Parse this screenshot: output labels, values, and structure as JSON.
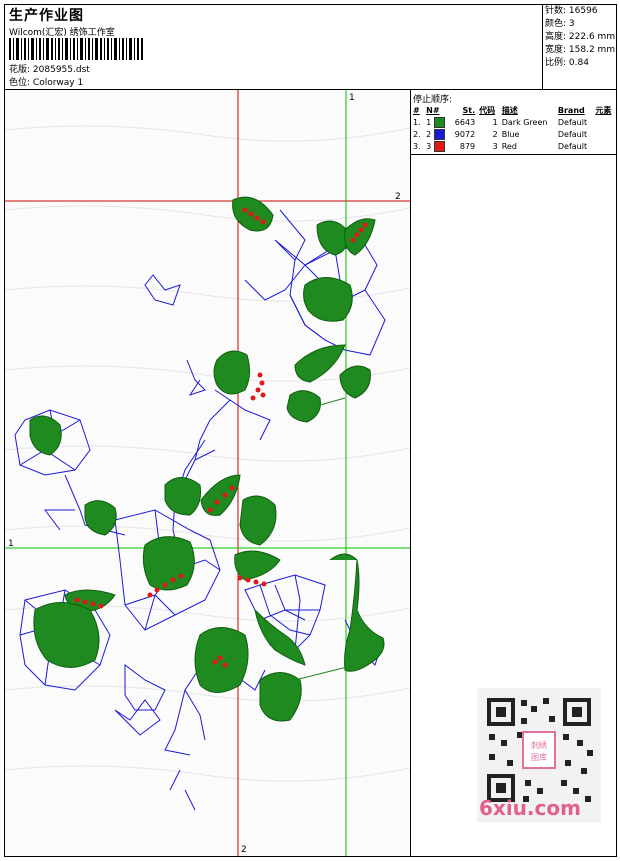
{
  "header": {
    "title": "生产作业图",
    "subtitle": "Wilcom(汇宏) 绣饰工作室",
    "design_label": "花版:",
    "design_value": "2085955.dst",
    "colorway_label": "色位:",
    "colorway_value": "Colorway 1"
  },
  "stats": [
    {
      "label": "针数:",
      "value": "16596"
    },
    {
      "label": "颜色:",
      "value": "3"
    },
    {
      "label": "高度:",
      "value": "222.6 mm"
    },
    {
      "label": "宽度:",
      "value": "158.2 mm"
    },
    {
      "label": "比例:",
      "value": "0.84"
    }
  ],
  "stop_sequence": {
    "caption": "停止顺序:",
    "columns": [
      "#",
      "N#",
      "St.",
      "代码",
      "描述",
      "Brand",
      "元素"
    ],
    "rows": [
      {
        "n": "1.",
        "stop": "1",
        "color": "#1f8a1f",
        "stitches": "6643",
        "code": "1",
        "desc": "Dark Green",
        "brand": "Default"
      },
      {
        "n": "2.",
        "stop": "2",
        "color": "#1a1ad6",
        "stitches": "9072",
        "code": "2",
        "desc": "Blue",
        "brand": "Default"
      },
      {
        "n": "3.",
        "stop": "3",
        "color": "#e01818",
        "stitches": "879",
        "code": "3",
        "desc": "Red",
        "brand": "Default"
      }
    ]
  },
  "guides": {
    "red_v_label": "2",
    "red_h_label": "2",
    "green_v_label": "1",
    "green_h_label": "1"
  },
  "watermark": {
    "brand": "6xiu.com",
    "seal": "刺绣图库"
  },
  "colors": {
    "thread_green": "#1f8a1f",
    "thread_blue": "#1a1ad6",
    "thread_red": "#e01818",
    "guide_red": "#d00000",
    "guide_green": "#00c000"
  }
}
